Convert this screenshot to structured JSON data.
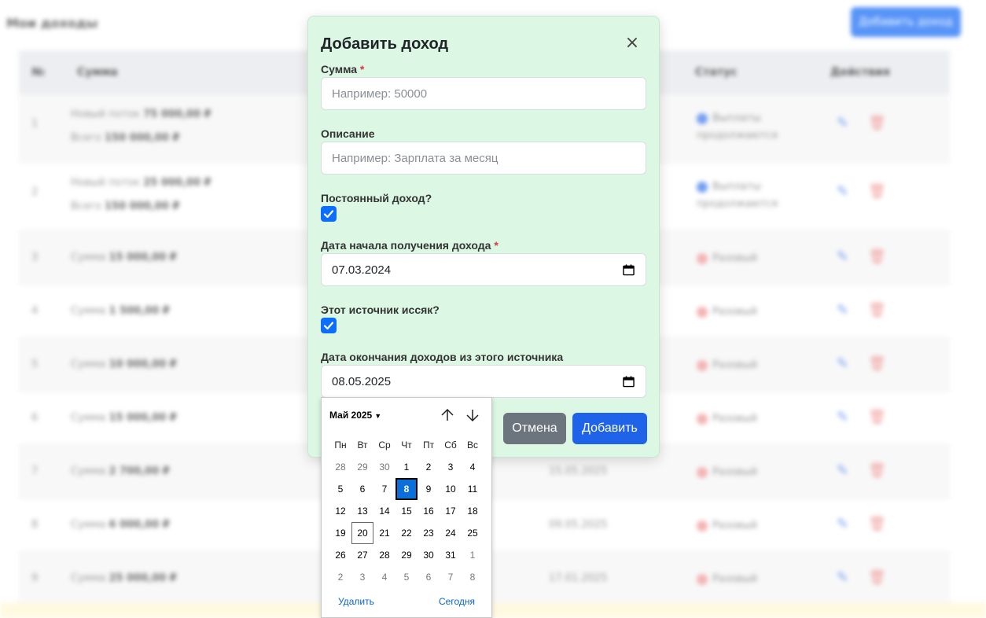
{
  "background": {
    "page_title": "Мои доходы",
    "add_button": "Добавить доход",
    "columns": [
      "№",
      "Сумма",
      "Статус",
      "Действия"
    ],
    "rows": [
      {
        "num": "1",
        "line1_label": "Новый поток",
        "line1_value": "75 000,00 ₽",
        "line2_label": "Всего",
        "line2_value": "150 000,00 ₽",
        "date": "",
        "status": "Выплаты продолжаются",
        "status_color": "blue"
      },
      {
        "num": "2",
        "line1_label": "Новый поток",
        "line1_value": "25 000,00 ₽",
        "line2_label": "Всего",
        "line2_value": "150 000,00 ₽",
        "date": "",
        "status": "Выплаты продолжаются",
        "status_color": "blue"
      },
      {
        "num": "3",
        "line1_label": "Сумма",
        "line1_value": "15 000,00 ₽",
        "date": "",
        "status": "Разовый",
        "status_color": "red"
      },
      {
        "num": "4",
        "line1_label": "Сумма",
        "line1_value": "1 500,00 ₽",
        "date": "",
        "status": "Разовый",
        "status_color": "red"
      },
      {
        "num": "5",
        "line1_label": "Сумма",
        "line1_value": "10 000,00 ₽",
        "date": "",
        "status": "Разовый",
        "status_color": "red"
      },
      {
        "num": "6",
        "line1_label": "Сумма",
        "line1_value": "15 000,00 ₽",
        "date": "",
        "status": "Разовый",
        "status_color": "red"
      },
      {
        "num": "7",
        "line1_label": "Сумма",
        "line1_value": "2 700,00 ₽",
        "date": "15.05.2025",
        "status": "Разовый",
        "status_color": "red"
      },
      {
        "num": "8",
        "line1_label": "Сумма",
        "line1_value": "6 000,00 ₽",
        "date": "09.05.2025",
        "status": "Разовый",
        "status_color": "red"
      },
      {
        "num": "9",
        "line1_label": "Сумма",
        "line1_value": "25 000,00 ₽",
        "date": "17.01.2025",
        "status": "Разовый",
        "status_color": "red"
      }
    ]
  },
  "modal": {
    "title": "Добавить доход",
    "amount": {
      "label": "Сумма",
      "required": "*",
      "placeholder": "Например: 50000"
    },
    "description": {
      "label": "Описание",
      "placeholder": "Например: Зарплата за месяц"
    },
    "permanent": {
      "label": "Постоянный доход?",
      "checked": true
    },
    "start_date": {
      "label": "Дата начала получения дохода",
      "required": "*",
      "value": "07.03.2024"
    },
    "ended": {
      "label": "Этот источник иссяк?",
      "checked": true
    },
    "end_date": {
      "label": "Дата окончания доходов из этого источника",
      "value": "08.05.2025"
    },
    "cancel_button": "Отмена",
    "submit_button": "Добавить"
  },
  "datepicker": {
    "month_label": "Май 2025",
    "weekdays": [
      "Пн",
      "Вт",
      "Ср",
      "Чт",
      "Пт",
      "Сб",
      "Вс"
    ],
    "weeks": [
      [
        "28",
        "29",
        "30",
        "1",
        "2",
        "3",
        "4"
      ],
      [
        "5",
        "6",
        "7",
        "8",
        "9",
        "10",
        "11"
      ],
      [
        "12",
        "13",
        "14",
        "15",
        "16",
        "17",
        "18"
      ],
      [
        "19",
        "20",
        "21",
        "22",
        "23",
        "24",
        "25"
      ],
      [
        "26",
        "27",
        "28",
        "29",
        "30",
        "31",
        "1"
      ],
      [
        "2",
        "3",
        "4",
        "5",
        "6",
        "7",
        "8"
      ]
    ],
    "selected_day": "8",
    "today_day": "20",
    "clear_label": "Удалить",
    "today_label": "Сегодня"
  },
  "colors": {
    "modal_bg": "#dcf8e4",
    "primary": "#1f63e8",
    "checkbox": "#0d6efd",
    "cancel": "#6c757d",
    "required": "#dc3545"
  }
}
